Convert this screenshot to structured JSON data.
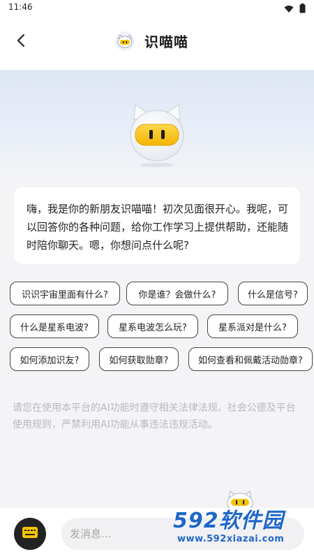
{
  "status_bar": {
    "time": "11:46"
  },
  "header": {
    "title": "识喵喵"
  },
  "greeting": {
    "text": "嗨，我是你的新朋友识喵喵！初次见面很开心。我呢，可以回答你的各种问题，给你工作学习上提供帮助，还能随时陪你聊天。嗯，你想问点什么呢?"
  },
  "suggestions": [
    "识识宇宙里面有什么?",
    "你是谁？会做什么?",
    "什么是信号?",
    "什么是星系电波?",
    "星系电波怎么玩?",
    "星系派对是什么?",
    "如何添加识友?",
    "如何获取勋章?",
    "如何查看和佩戴活动勋章?"
  ],
  "notice": {
    "text": "请您在使用本平台的AI功能时遵守相关法律法规、社会公德及平台使用规则，严禁利用AI功能从事违法违规活动。"
  },
  "input": {
    "placeholder": "发消息..."
  },
  "watermark": {
    "main": "592软件园",
    "url": "www.592xiazai.com"
  },
  "colors": {
    "accent_yellow": "#f6c300",
    "watermark_blue": "#1f67c8",
    "dark_button": "#232323"
  },
  "icons": [
    "wifi-icon",
    "battery-icon",
    "back-arrow-icon",
    "mascot-avatar-icon",
    "keyboard-icon"
  ]
}
